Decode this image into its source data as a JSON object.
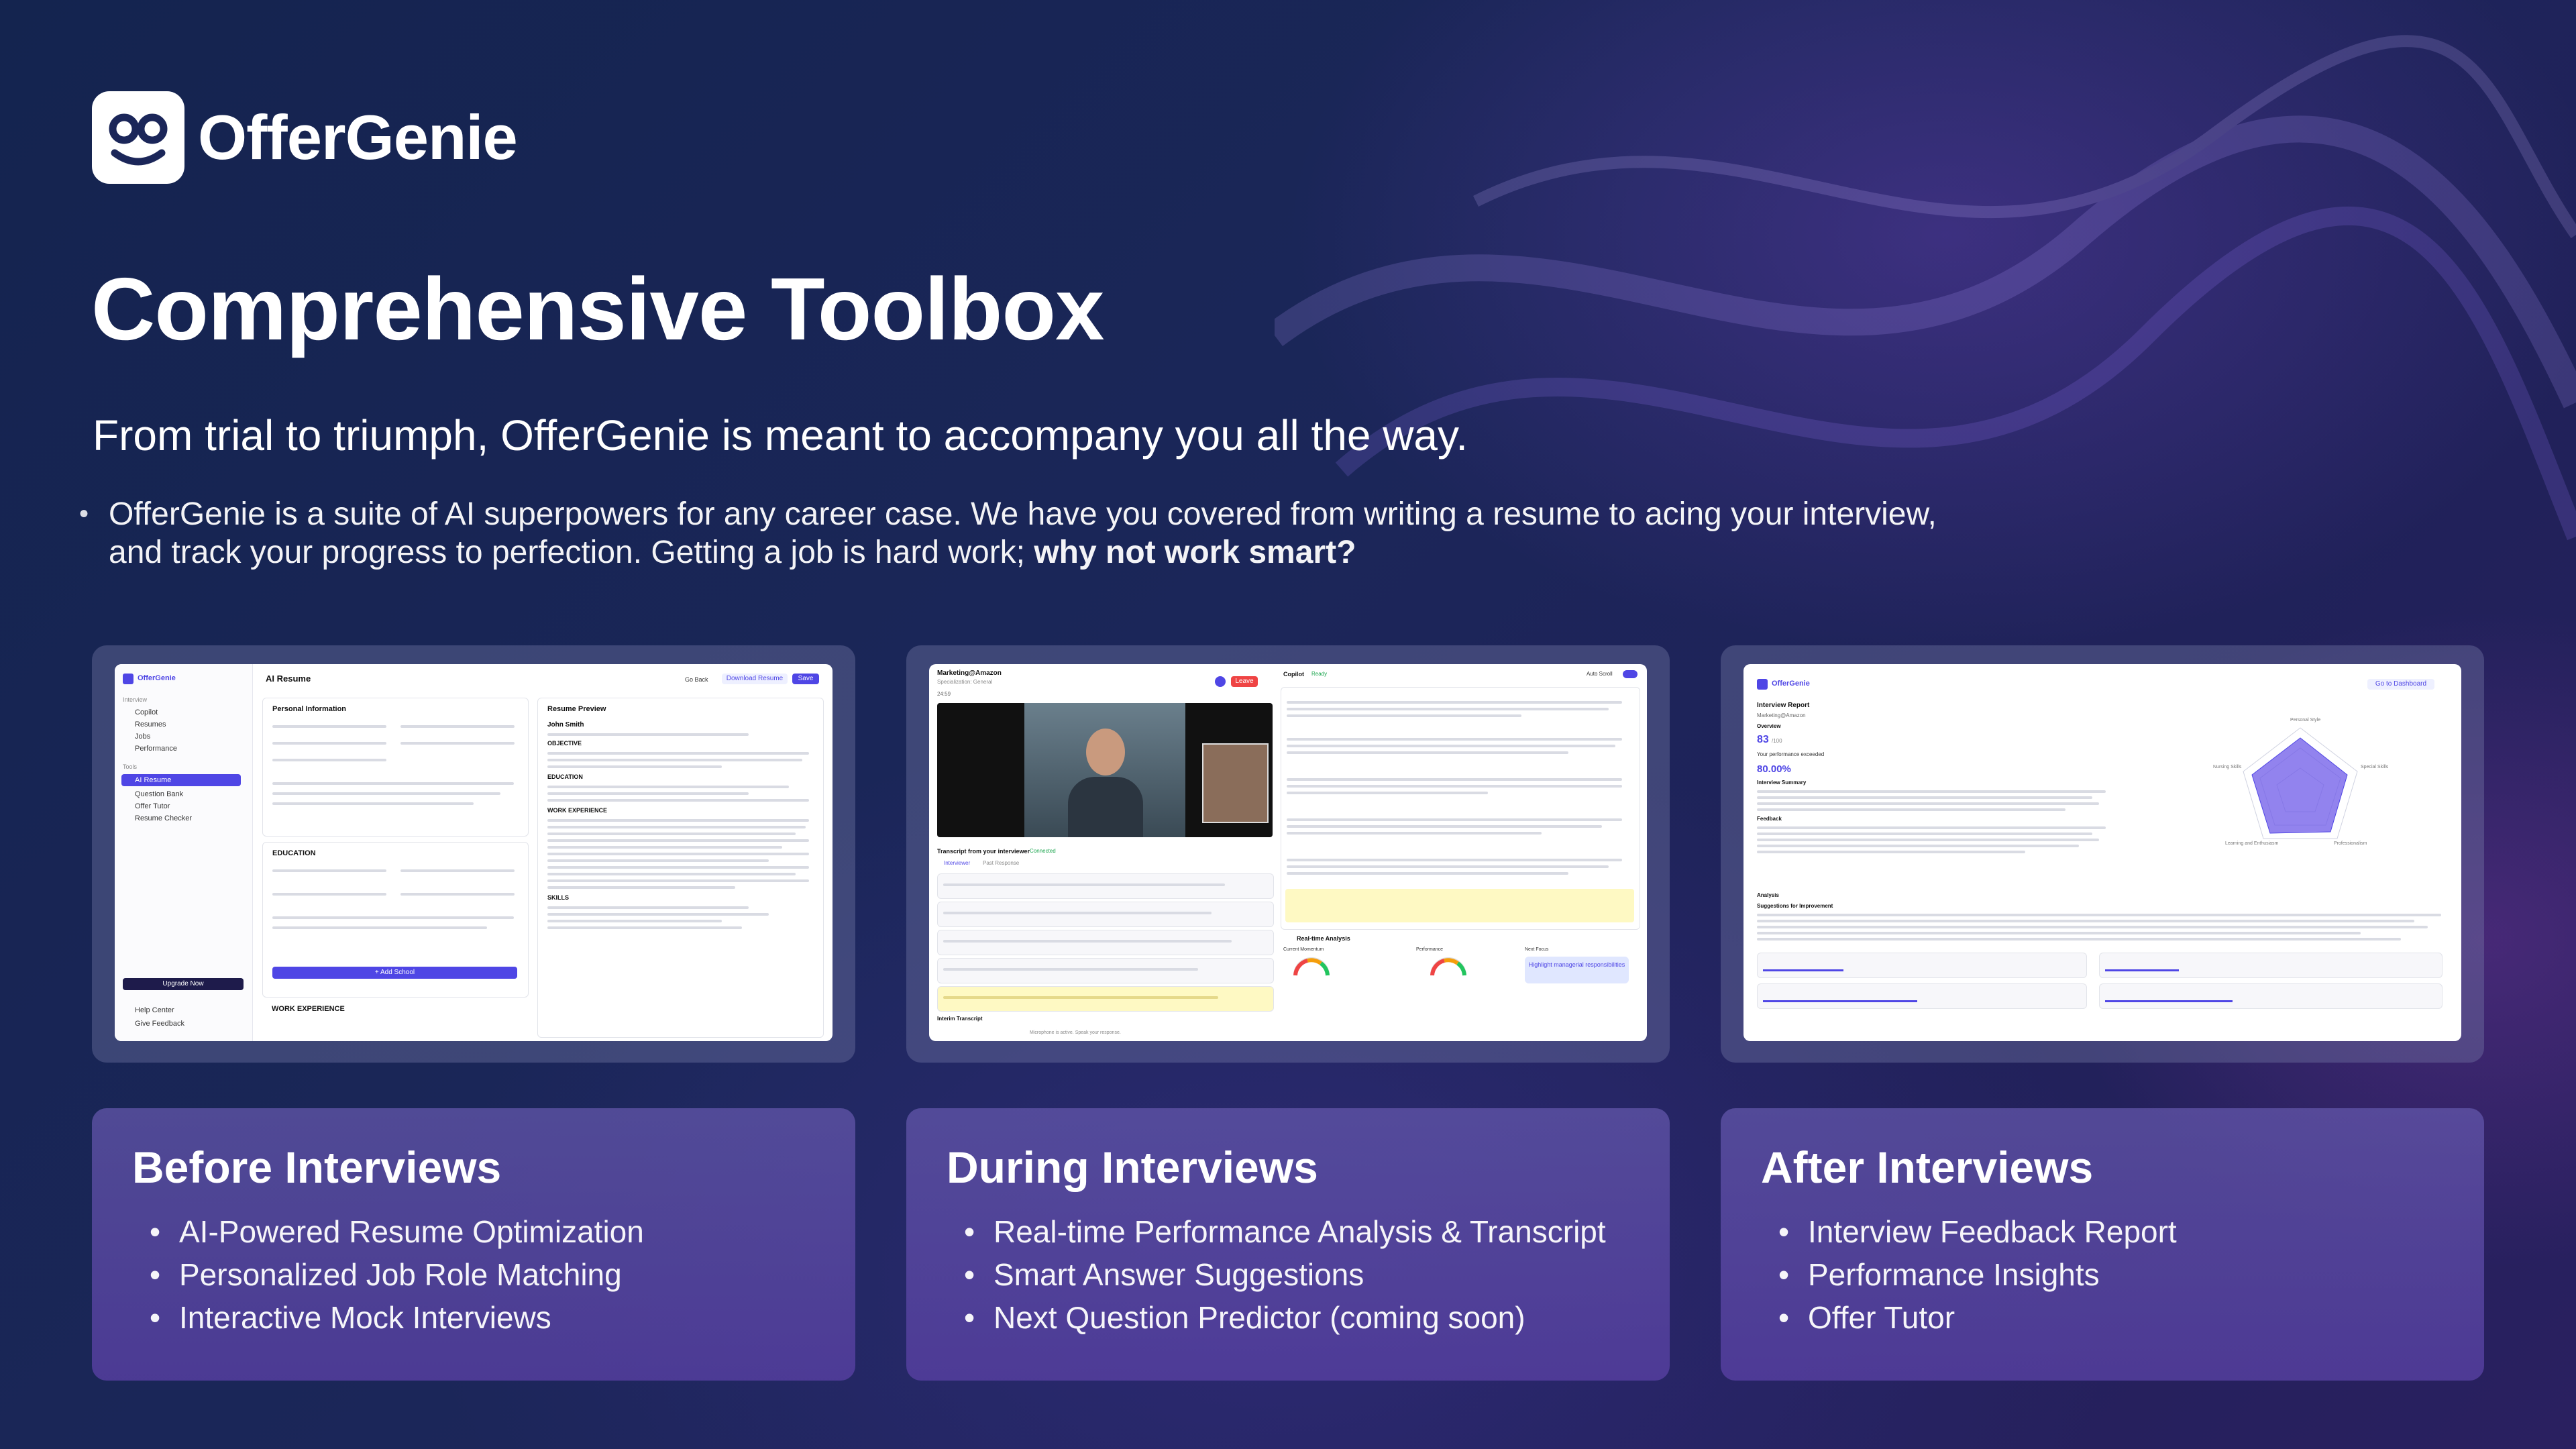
{
  "brand": {
    "name": "OfferGenie"
  },
  "header": {
    "title": "Comprehensive Toolbox",
    "subtitle": "From trial to triumph, OfferGenie is meant to accompany you all the way.",
    "intro_line1": "OfferGenie is a suite of AI superpowers for any career case. We have you covered from writing a resume to acing your interview,",
    "intro_line2": "and track your progress to perfection. Getting a job is hard work; ",
    "intro_bold": "why not work smart?"
  },
  "screens": {
    "resume": {
      "app": "OfferGenie",
      "page_title": "AI Resume",
      "back": "Go Back",
      "download": "Download Resume",
      "save": "Save",
      "nav_section": "Interview",
      "nav": [
        "Copilot",
        "Resumes",
        "Jobs",
        "Performance"
      ],
      "tools_section": "Tools",
      "tools": [
        "AI Resume",
        "Question Bank",
        "Offer Tutor",
        "Resume Checker"
      ],
      "personal": "Personal Information",
      "preview": "Resume Preview",
      "name": "John Smith",
      "objective": "OBJECTIVE",
      "education": "EDUCATION",
      "work": "WORK EXPERIENCE",
      "skills": "SKILLS",
      "add_school": "+ Add School",
      "upgrade": "Upgrade Now",
      "help": "Help Center",
      "feedback": "Give Feedback"
    },
    "copilot": {
      "role": "Marketing@Amazon",
      "spec": "Specialization: General",
      "timer": "24:59",
      "leave": "Leave",
      "copilot": "Copilot",
      "ready": "Ready",
      "auto_scroll": "Auto Scroll",
      "transcript": "Transcript from your interviewer",
      "connected": "Connected",
      "tab1": "Interviewer",
      "tab2": "Past Response",
      "analysis": "Real-time Analysis",
      "momentum": "Current Momentum",
      "performance": "Performance",
      "next_focus": "Next Focus",
      "focus_value": "Highlight managerial responsibilities",
      "interim": "Interim Transcript",
      "footer": "Microphone is active. Speak your response."
    },
    "report": {
      "app": "OfferGenie",
      "title": "Interview Report",
      "role": "Marketing@Amazon",
      "overview": "Overview",
      "score": "83",
      "score_max": "/100",
      "exceeded_label": "Your performance exceeded",
      "percent": "80.00%",
      "summary": "Interview Summary",
      "feedback": "Feedback",
      "analysis": "Analysis",
      "suggestions": "Suggestions for Improvement",
      "dashboard": "Go to Dashboard",
      "radar_labels": [
        "Personal Style",
        "Special Skills",
        "Professionalism",
        "Learning and Enthusiasm",
        "Nursing Skills"
      ]
    }
  },
  "cards": [
    {
      "title": "Before Interviews",
      "items": [
        "AI-Powered Resume Optimization",
        "Personalized Job Role Matching",
        "Interactive Mock Interviews"
      ]
    },
    {
      "title": "During Interviews",
      "items": [
        "Real-time Performance Analysis & Transcript",
        "Smart Answer Suggestions",
        "Next Question Predictor (coming soon)"
      ]
    },
    {
      "title": "After Interviews",
      "items": [
        "Interview Feedback Report",
        "Performance Insights",
        "Offer Tutor"
      ]
    }
  ],
  "colors": {
    "accent": "#4f46e5",
    "card": "#5a48a8",
    "background": "#1a2456"
  }
}
